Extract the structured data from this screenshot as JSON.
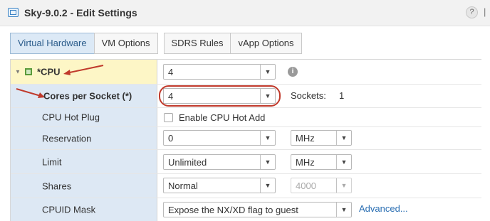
{
  "window": {
    "title": "Sky-9.0.2 - Edit Settings",
    "help_symbol": "?",
    "more_symbol": "|"
  },
  "tabs": [
    {
      "label": "Virtual Hardware",
      "active": true
    },
    {
      "label": "VM Options",
      "active": false
    },
    {
      "label": "SDRS Rules",
      "active": false
    },
    {
      "label": "vApp Options",
      "active": false
    }
  ],
  "rows": {
    "cpu": {
      "label": "*CPU",
      "value": "4",
      "info_symbol": "i"
    },
    "cores": {
      "label": "Cores per Socket (*)",
      "value": "4",
      "sockets_label": "Sockets:",
      "sockets_value": "1"
    },
    "hotplug": {
      "label": "CPU Hot Plug",
      "checkbox_label": "Enable CPU Hot Add",
      "checked": false
    },
    "reservation": {
      "label": "Reservation",
      "value": "0",
      "unit": "MHz"
    },
    "limit": {
      "label": "Limit",
      "value": "Unlimited",
      "unit": "MHz"
    },
    "shares": {
      "label": "Shares",
      "value": "Normal",
      "shares_value": "4000"
    },
    "cpuid": {
      "label": "CPUID Mask",
      "value": "Expose the NX/XD flag to guest",
      "link": "Advanced..."
    }
  },
  "icons": {
    "dropdown_arrow": "▼",
    "expander": "▼",
    "scroll_up": "▲",
    "scroll_side": ":"
  },
  "colors": {
    "selected_row": "#fdf6c6",
    "label_column": "#dde8f4",
    "active_tab": "#dce9f6",
    "annotation": "#c0392b",
    "link": "#2b6fb3"
  }
}
